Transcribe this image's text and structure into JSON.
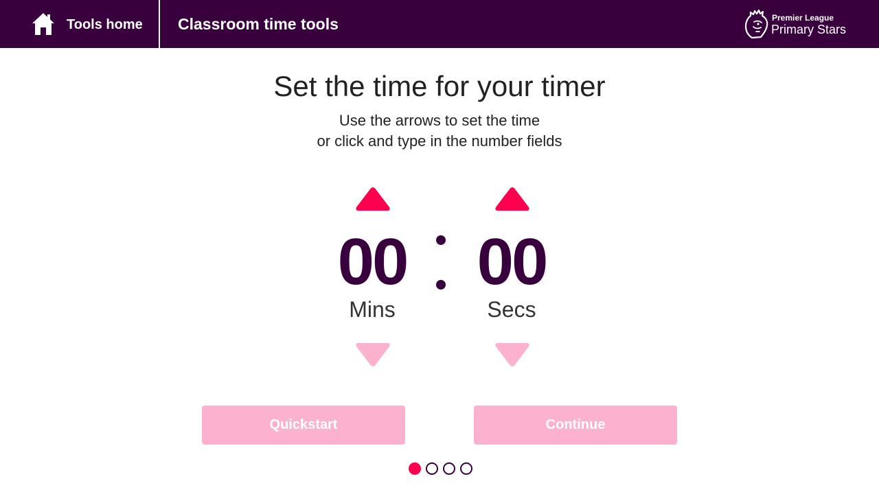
{
  "header": {
    "home_label": "Tools home",
    "title": "Classroom time tools",
    "brand_line1": "Premier League",
    "brand_line2": "Primary Stars",
    "background_color": "#38003c"
  },
  "main": {
    "title": "Set the time for your timer",
    "instruction_line1": "Use the arrows to set the time",
    "instruction_line2": "or click and type in the number fields"
  },
  "timer": {
    "minutes": "00",
    "minutes_label": "Mins",
    "seconds": "00",
    "seconds_label": "Secs",
    "up_arrow_color": "#ff004f",
    "down_arrow_color": "#fcb2ce",
    "digit_color": "#38003c"
  },
  "buttons": {
    "quickstart_label": "Quickstart",
    "continue_label": "Continue",
    "disabled_color": "#fcb2ce"
  },
  "pagination": {
    "total_steps": 4,
    "current_step": 1,
    "active_color": "#ff004f"
  },
  "icons": {
    "home": "home-icon",
    "brand": "premier-league-lion-logo",
    "increment": "triangle-up-icon",
    "decrement": "triangle-down-icon"
  }
}
